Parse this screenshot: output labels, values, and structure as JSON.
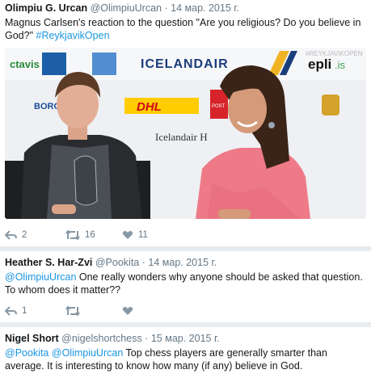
{
  "tweets": [
    {
      "name": "Olimpiu G. Urcan",
      "handle": "@OlimpiuUrcan",
      "sep": "·",
      "date": "14 мар. 2015 г.",
      "line1": "Magnus Carlsen's reaction to the question \"Are you religious? Do you believe in",
      "line2_text": "God?\" ",
      "hashtag": "#ReykjavikOpen",
      "media": {
        "sponsors": [
          "ctavis",
          "ICELANDAIR",
          "epli",
          ".is",
          "BORG",
          "DHL",
          "POST",
          "Icelandair H"
        ],
        "watermark": "#REYKJAVIKOPEN"
      },
      "replies": "2",
      "retweets": "16",
      "likes": "11"
    },
    {
      "name": "Heather S. Har-Zvi",
      "handle": "@Pookita",
      "sep": "·",
      "date": "14 мар. 2015 г.",
      "mention": "@OlimpiuUrcan",
      "text_a": " One really wonders why anyone should be asked that question.",
      "text_b": "To whom does it matter??",
      "replies": "1",
      "retweets": "",
      "likes": ""
    },
    {
      "name": "Nigel Short",
      "handle": "@nigelshortchess",
      "sep": "·",
      "date": "15 мар. 2015 г.",
      "mention1": "@Pookita",
      "mention2": "@OlimpiuUrcan",
      "text_a": " Top chess players are generally smarter than",
      "text_b": "average. It is interesting to know how many (if any) believe in God."
    }
  ],
  "colors": {
    "link": "#1b95e0",
    "meta": "#657786",
    "icon": "#8899a6",
    "background": "#e6ecf0"
  }
}
